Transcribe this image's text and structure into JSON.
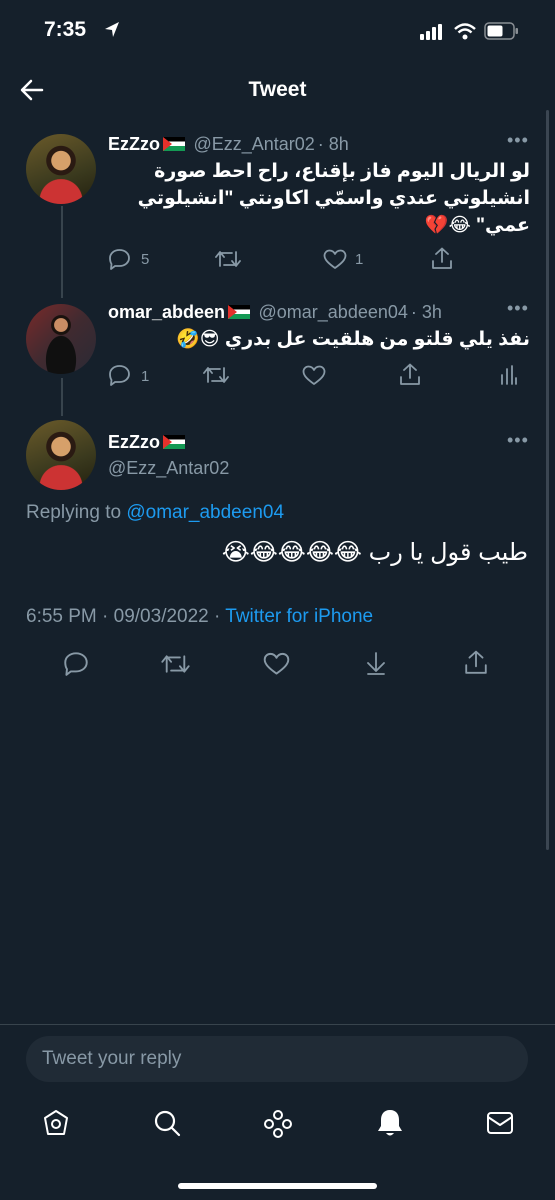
{
  "status": {
    "time": "7:35"
  },
  "nav": {
    "title": "Tweet"
  },
  "tweets": [
    {
      "name": "EzZzo",
      "handle": "@Ezz_Antar02",
      "time": "· 8h",
      "text": "لو الريال اليوم فاز بإقناع، راح احط صورة انشيلوتي عندي واسمّي اكاونتي \"انشيلوتي عمي\" 😂💔",
      "replies": "5",
      "likes": "1"
    },
    {
      "name": "omar_abdeen",
      "handle": "@omar_abdeen04",
      "time": "· 3h",
      "text": "نفذ يلي قلتو من هلقيت عل بدري 😎🤣",
      "replies": "1"
    }
  ],
  "main_tweet": {
    "name": "EzZzo",
    "handle": "@Ezz_Antar02",
    "replying_label": "Replying to",
    "replying_to": "@omar_abdeen04",
    "text": "طيب قول يا رب 😂😂😂😂😭",
    "timestamp": "6:55 PM · 09/03/2022 ·",
    "source": "Twitter for iPhone"
  },
  "composer": {
    "placeholder": "Tweet your reply"
  },
  "icons": {
    "reply": "reply-icon",
    "retweet": "retweet-icon",
    "like": "heart-icon",
    "share": "share-icon",
    "analytics": "analytics-icon",
    "download": "download-icon"
  },
  "tabbar": [
    "home-icon",
    "search-icon",
    "spaces-icon",
    "notifications-icon",
    "messages-icon"
  ],
  "colors": {
    "background": "#15202b",
    "accent": "#1d9bf0",
    "muted": "#8899a6",
    "border": "#38444d"
  }
}
